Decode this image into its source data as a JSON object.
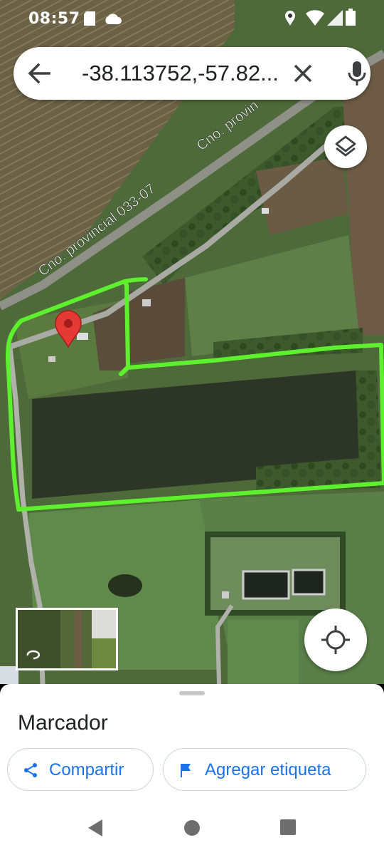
{
  "status_bar": {
    "time": "08:57",
    "icons": [
      "sd-card-icon",
      "cloud-icon",
      "location-icon",
      "wifi-icon",
      "signal-icon",
      "battery-icon"
    ]
  },
  "search_bar": {
    "query": "-38.113752,-57.82...",
    "icons": [
      "back-arrow-icon",
      "close-icon",
      "microphone-icon"
    ]
  },
  "map": {
    "road_labels": [
      "Cno. provincial 033-07",
      "Cno. provin"
    ],
    "marker_color": "#e53935",
    "boundary_color": "#5ef02e"
  },
  "bottom_sheet": {
    "title": "Marcador",
    "share_label": "Compartir",
    "add_label_label": "Agregar etiqueta",
    "accent_color": "#1a73e8"
  },
  "nav_bar": {
    "icons": [
      "back-triangle-icon",
      "home-circle-icon",
      "recents-square-icon"
    ]
  }
}
